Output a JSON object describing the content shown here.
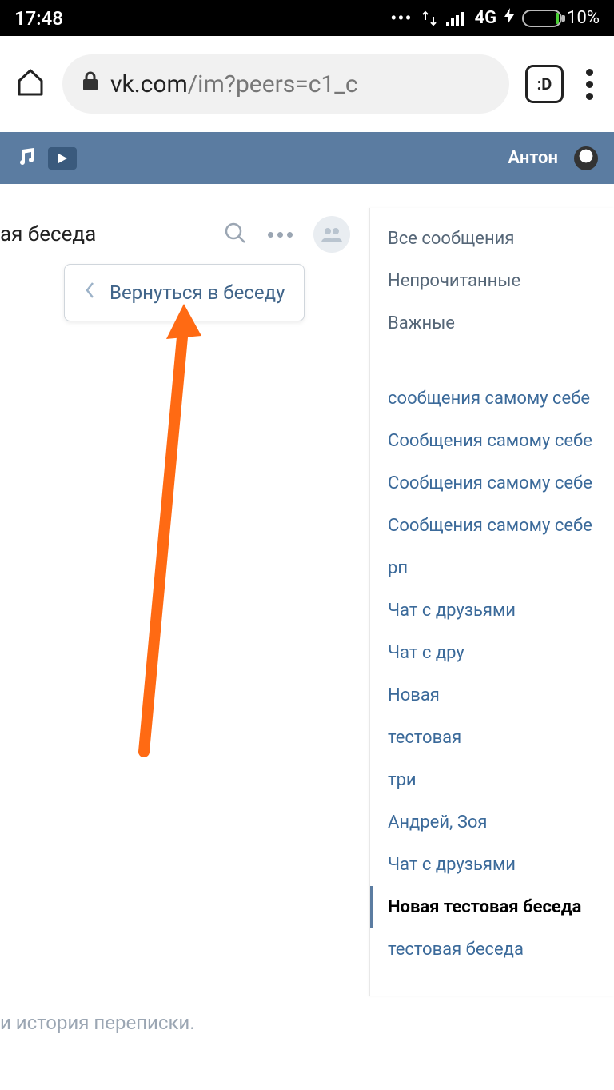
{
  "status": {
    "time": "17:48",
    "network_label": "4G",
    "battery_percent": "10%"
  },
  "browser": {
    "url_domain": "vk.com",
    "url_rest": "/im?peers=c1_c",
    "tabs_badge": ":D"
  },
  "vk_header": {
    "user_name": "Антон"
  },
  "chat": {
    "title": "ая беседа",
    "tooltip_label": "Вернуться в беседу",
    "history_text": "и история переписки."
  },
  "sidebar": {
    "filters": [
      {
        "label": "Все сообщения"
      },
      {
        "label": "Непрочитанные"
      },
      {
        "label": "Важные"
      }
    ],
    "chats": [
      {
        "label": "сообщения самому себе",
        "active": false
      },
      {
        "label": "Сообщения самому себе",
        "active": false
      },
      {
        "label": "Сообщения самому себе",
        "active": false
      },
      {
        "label": "Сообщения самому себе",
        "active": false
      },
      {
        "label": "рп",
        "active": false
      },
      {
        "label": "Чат с друзьями",
        "active": false
      },
      {
        "label": "Чат с дру",
        "active": false
      },
      {
        "label": "Новая",
        "active": false
      },
      {
        "label": "тестовая",
        "active": false
      },
      {
        "label": "три",
        "active": false
      },
      {
        "label": "Андрей, Зоя",
        "active": false
      },
      {
        "label": "Чат с друзьями",
        "active": false
      },
      {
        "label": "Новая тестовая беседа",
        "active": true
      },
      {
        "label": "тестовая беседа",
        "active": false
      }
    ]
  }
}
